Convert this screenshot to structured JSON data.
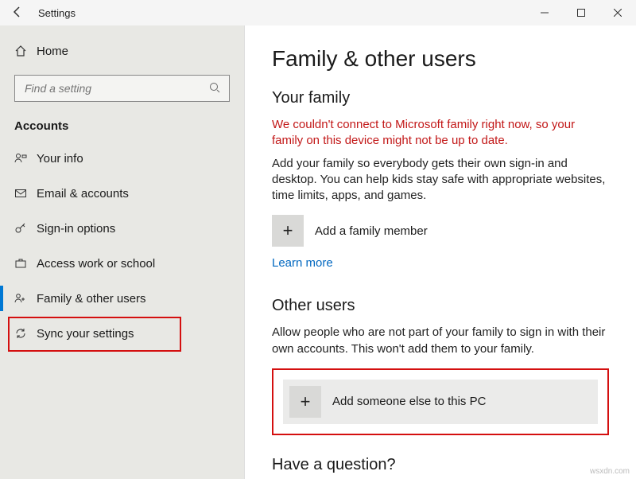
{
  "window": {
    "title": "Settings"
  },
  "sidebar": {
    "home": "Home",
    "search_placeholder": "Find a setting",
    "section": "Accounts",
    "items": [
      {
        "label": "Your info"
      },
      {
        "label": "Email & accounts"
      },
      {
        "label": "Sign-in options"
      },
      {
        "label": "Access work or school"
      },
      {
        "label": "Family & other users"
      },
      {
        "label": "Sync your settings"
      }
    ]
  },
  "main": {
    "heading": "Family & other users",
    "family_heading": "Your family",
    "family_error": "We couldn't connect to Microsoft family right now, so your family on this device might not be up to date.",
    "family_desc": "Add your family so everybody gets their own sign-in and desktop. You can help kids stay safe with appropriate websites, time limits, apps, and games.",
    "add_family_label": "Add a family member",
    "learn_more": "Learn more",
    "other_heading": "Other users",
    "other_desc": "Allow people who are not part of your family to sign in with their own accounts. This won't add them to your family.",
    "add_other_label": "Add someone else to this PC",
    "question_heading": "Have a question?"
  },
  "watermark": "wsxdn.com"
}
